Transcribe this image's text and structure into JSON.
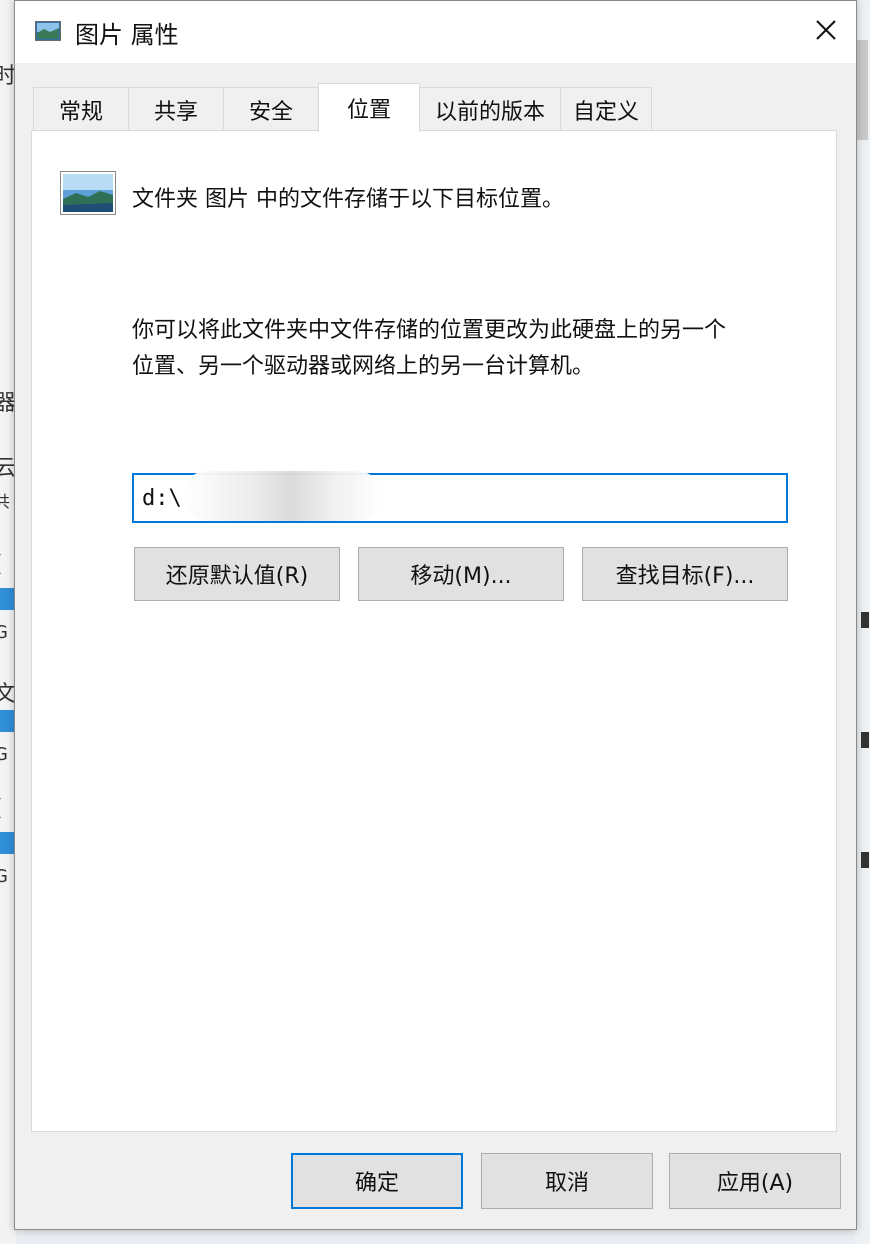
{
  "window": {
    "title": "图片 属性",
    "close_icon": "close-icon"
  },
  "tabs": [
    {
      "label": "常规"
    },
    {
      "label": "共享"
    },
    {
      "label": "安全"
    },
    {
      "label": "位置",
      "active": true
    },
    {
      "label": "以前的版本"
    },
    {
      "label": "自定义"
    }
  ],
  "location": {
    "folder_icon": "landscape-folder-icon",
    "summary": "文件夹 图片 中的文件存储于以下目标位置。",
    "explain_line1": "你可以将此文件夹中文件存储的位置更改为此硬盘上的另一个",
    "explain_line2": "位置、另一个驱动器或网络上的另一台计算机。",
    "path_value": "d:\\",
    "buttons": {
      "restore_default": "还原默认值(R)",
      "move": "移动(M)...",
      "find_target": "查找目标(F)..."
    }
  },
  "footer": {
    "ok": "确定",
    "cancel": "取消",
    "apply": "应用(A)"
  },
  "colors": {
    "accent": "#0078d7",
    "dialog_bg": "#f0f0f0",
    "button_bg": "#e1e1e1"
  }
}
